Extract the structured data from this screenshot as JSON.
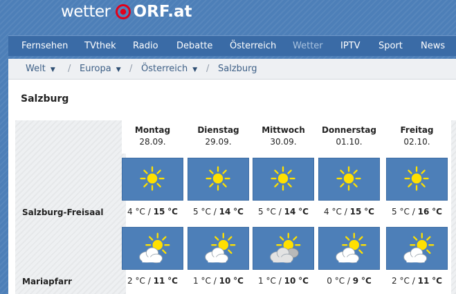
{
  "brand": {
    "word": "wetter",
    "suffix": "ORF.at",
    "accent": "#e2001a"
  },
  "nav": {
    "items": [
      "Fernsehen",
      "TVthek",
      "Radio",
      "Debatte",
      "Österreich",
      "Wetter",
      "IPTV",
      "Sport",
      "News"
    ],
    "active": "Wetter"
  },
  "breadcrumb": {
    "items": [
      {
        "label": "Welt",
        "dropdown": true
      },
      {
        "label": "Europa",
        "dropdown": true
      },
      {
        "label": "Österreich",
        "dropdown": true
      },
      {
        "label": "Salzburg",
        "dropdown": false
      }
    ],
    "separator": "/",
    "dropdown_glyph": "▼"
  },
  "page": {
    "title": "Salzburg"
  },
  "unit": "°C",
  "slash": "/",
  "days": [
    {
      "name": "Montag",
      "date": "28.09."
    },
    {
      "name": "Dienstag",
      "date": "29.09."
    },
    {
      "name": "Mittwoch",
      "date": "30.09."
    },
    {
      "name": "Donnerstag",
      "date": "01.10."
    },
    {
      "name": "Freitag",
      "date": "02.10."
    }
  ],
  "locations": [
    {
      "name": "Salzburg-Freisaal",
      "forecast": [
        {
          "icon": "sun-icon",
          "min": "4",
          "max": "15"
        },
        {
          "icon": "sun-icon",
          "min": "5",
          "max": "14"
        },
        {
          "icon": "sun-icon",
          "min": "5",
          "max": "14"
        },
        {
          "icon": "sun-icon",
          "min": "4",
          "max": "15"
        },
        {
          "icon": "sun-icon",
          "min": "5",
          "max": "16"
        }
      ]
    },
    {
      "name": "Mariapfarr",
      "forecast": [
        {
          "icon": "sun-cloud-icon",
          "min": "2",
          "max": "11"
        },
        {
          "icon": "sun-cloud-icon",
          "min": "1",
          "max": "10"
        },
        {
          "icon": "sun-cloud-grey-icon",
          "min": "1",
          "max": "10"
        },
        {
          "icon": "sun-cloud-icon",
          "min": "0",
          "max": "9"
        },
        {
          "icon": "sun-cloud-icon",
          "min": "2",
          "max": "11"
        }
      ]
    }
  ],
  "colors": {
    "bg": "#4d7fb8",
    "nav": "#3a6ba6",
    "sun": "#ffe000",
    "cloud": "#ffffff"
  }
}
